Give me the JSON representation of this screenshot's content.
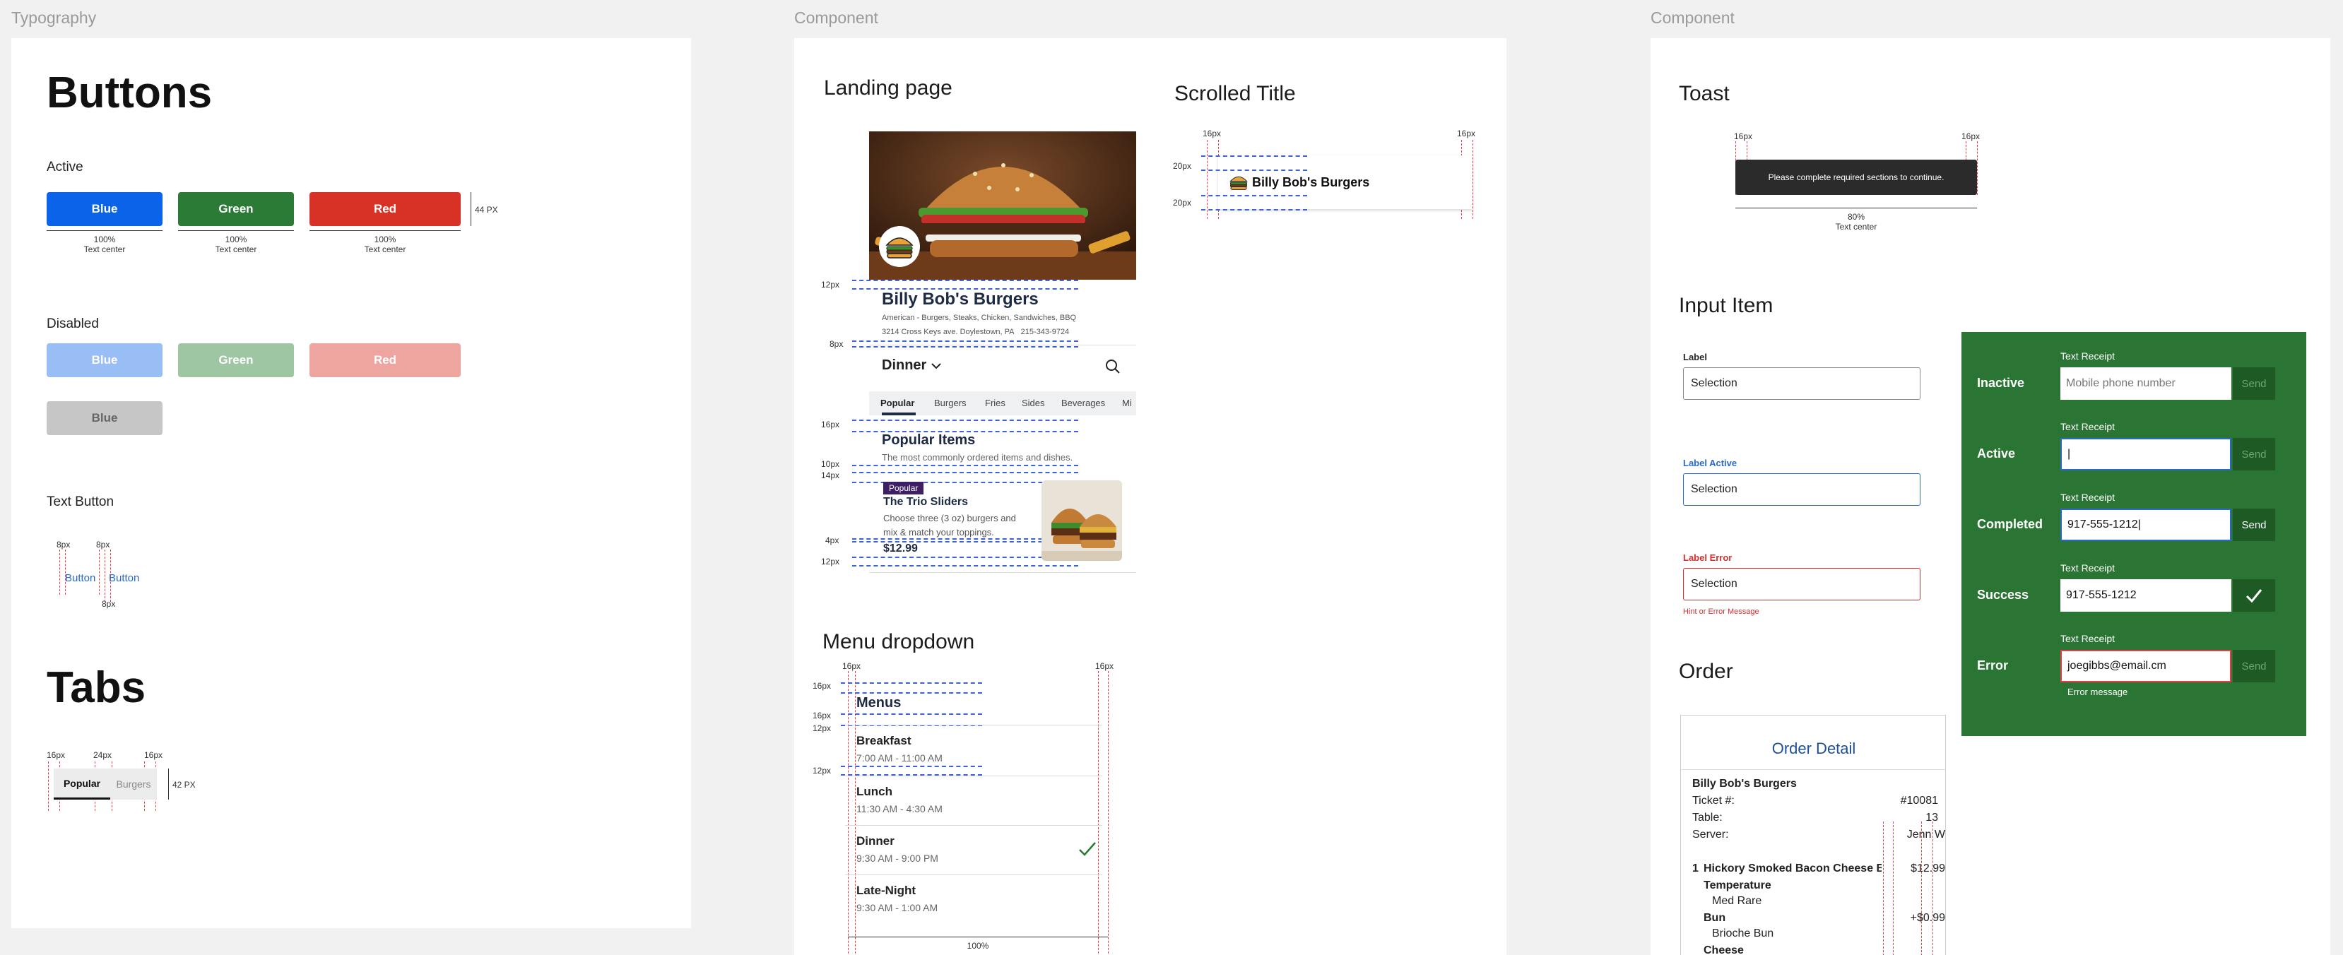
{
  "frames": {
    "left": "Typography",
    "middle": "Component",
    "right": "Component"
  },
  "buttons_frame": {
    "title": "Buttons",
    "active_label": "Active",
    "active_buttons": [
      {
        "label": "Blue",
        "color": "#0a63e8"
      },
      {
        "label": "Green",
        "color": "#2b7a36"
      },
      {
        "label": "Red",
        "color": "#d83226"
      }
    ],
    "width_note": "100%",
    "align_note": "Text center",
    "height_note": "44 PX",
    "disabled_label": "Disabled",
    "disabled_buttons": [
      {
        "label": "Blue",
        "color": "#99bdf5"
      },
      {
        "label": "Green",
        "color": "#9fc6a3"
      },
      {
        "label": "Red",
        "color": "#eea59f"
      }
    ],
    "disabled_gray": {
      "label": "Blue",
      "color": "#c6c6c6"
    },
    "text_button_label": "Text Button",
    "text_buttons": [
      "Button",
      "Button"
    ],
    "spacing_8": "8px",
    "tabs_title": "Tabs",
    "tabs_spacing": [
      "16px",
      "24px",
      "16px"
    ],
    "tabs": [
      "Popular",
      "Burgers"
    ],
    "tabs_height": "42 PX"
  },
  "landing": {
    "title": "Landing page",
    "restaurant": "Billy Bob's Burgers",
    "cuisine": "American - Burgers, Steaks, Chicken, Sandwiches, BBQ",
    "address": "3214 Cross Keys ave. Doylestown, PA",
    "phone": "215-343-9724",
    "menu_select": "Dinner",
    "categories": [
      "Popular",
      "Burgers",
      "Fries",
      "Sides",
      "Beverages",
      "Mi"
    ],
    "section_title": "Popular Items",
    "section_sub": "The most commonly ordered items and dishes.",
    "badge": "Popular",
    "item_name": "The Trio Sliders",
    "item_desc_1": "Choose three (3 oz) burgers and",
    "item_desc_2": "mix & match your toppings.",
    "item_price": "$12.99",
    "spacings": [
      "12px",
      "8px",
      "16px",
      "10px",
      "14px",
      "4px",
      "12px"
    ]
  },
  "scrolled": {
    "title": "Scrolled Title",
    "restaurant": "Billy Bob's Burgers",
    "spacing_16": "16px",
    "spacing_20": "20px"
  },
  "menu_dropdown": {
    "title": "Menu dropdown",
    "header": "Menus",
    "items": [
      {
        "name": "Breakfast",
        "hours": "7:00 AM - 11:00 AM"
      },
      {
        "name": "Lunch",
        "hours": "11:30 AM - 4:30 AM"
      },
      {
        "name": "Dinner",
        "hours": "9:30 AM - 9:00 PM",
        "selected": true
      },
      {
        "name": "Late-Night",
        "hours": "9:30 AM - 1:00 AM"
      }
    ],
    "spacings": [
      "16px",
      "16px",
      "16px",
      "16px",
      "12px",
      "12px"
    ],
    "width_note": "100%"
  },
  "toast": {
    "title": "Toast",
    "message": "Please complete required sections to continue.",
    "spacing": "16px",
    "width_note": "80%",
    "align_note": "Text center"
  },
  "input_item": {
    "title": "Input Item",
    "default": {
      "label": "Label",
      "value": "Selection"
    },
    "active": {
      "label": "Label Active",
      "value": "Selection"
    },
    "error": {
      "label": "Label Error",
      "value": "Selection",
      "hint": "Hint or Error Message"
    }
  },
  "receipt_states": {
    "field_label": "Text Receipt",
    "states": [
      {
        "state": "Inactive",
        "value": "",
        "placeholder": "Mobile phone number",
        "action": "Send"
      },
      {
        "state": "Active",
        "value": "|",
        "placeholder": "",
        "action": "Send"
      },
      {
        "state": "Completed",
        "value": "917-555-1212|",
        "placeholder": "",
        "action": "Send"
      },
      {
        "state": "Success",
        "value": "917-555-1212",
        "placeholder": "",
        "action": "check"
      },
      {
        "state": "Error",
        "value": "joegibbs@email.cm",
        "placeholder": "",
        "action": "Send"
      }
    ],
    "error_message": "Error message",
    "bg_color": "#2a7434"
  },
  "order": {
    "title": "Order",
    "card_title": "Order Detail",
    "restaurant": "Billy Bob's Burgers",
    "ticket_label": "Ticket #:",
    "ticket_value": "#10081",
    "table_label": "Table:",
    "table_value": "13",
    "server_label": "Server:",
    "server_value": "Jenn W",
    "line_qty": "1",
    "line_name": "Hickory Smoked Bacon Cheese B...",
    "line_price": "$12.99",
    "temp_label": "Temperature",
    "temp_value": "Med Rare",
    "bun_label": "Bun",
    "bun_price": "+$0.99",
    "bun_value": "Brioche Bun",
    "cheese_label": "Cheese"
  }
}
